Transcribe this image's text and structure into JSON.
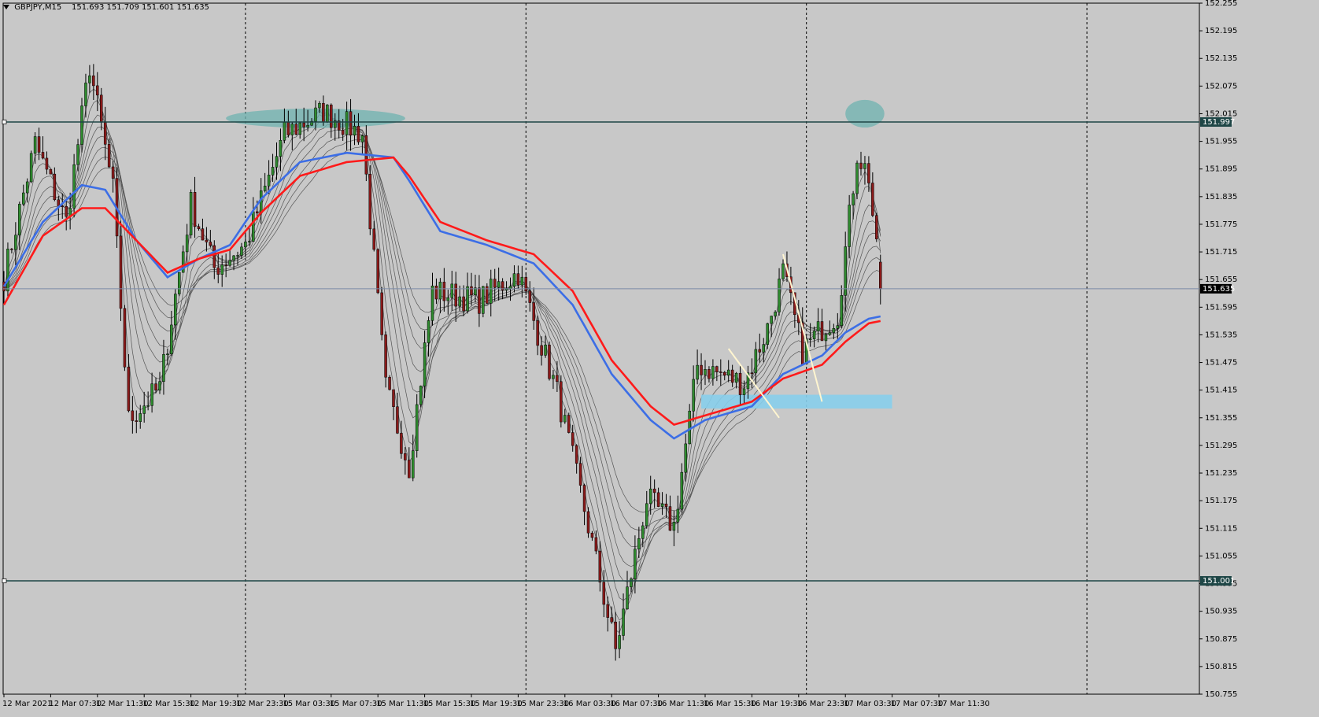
{
  "header": {
    "symbol": "GBPJPY,M15",
    "quotes": "151.693 151.709 151.601 151.635"
  },
  "colors": {
    "background": "#c8c8c8",
    "grid": "#000000",
    "bull_candle": "#2e8b2e",
    "bear_candle": "#8b1a1a",
    "wick": "#000000",
    "ema_red": "#ff1a1a",
    "ema_blue": "#3c6ee6",
    "ema_thin": "#555555",
    "hline": "#1e4646",
    "current_price_line": "#7c8aa6",
    "zone_blue": "#87ceeb",
    "ellipse": "#6fb3b0",
    "trendline": "#fff5d0"
  },
  "chart_data": {
    "type": "candlestick",
    "title": "",
    "symbol": "GBPJPY",
    "timeframe": "M15",
    "last_bar": {
      "open": 151.693,
      "high": 151.709,
      "low": 151.601,
      "close": 151.635
    },
    "ylim": [
      150.755,
      152.255
    ],
    "y_ticks": [
      "152.255",
      "152.195",
      "152.135",
      "152.075",
      "152.015",
      "151.955",
      "151.895",
      "151.835",
      "151.775",
      "151.715",
      "151.655",
      "151.595",
      "151.535",
      "151.475",
      "151.415",
      "151.355",
      "151.295",
      "151.235",
      "151.175",
      "151.115",
      "151.055",
      "150.995",
      "150.935",
      "150.875",
      "150.815",
      "150.755"
    ],
    "x_ticks": [
      "12 Mar 2021",
      "12 Mar 07:30",
      "12 Mar 11:30",
      "12 Mar 15:30",
      "12 Mar 19:30",
      "12 Mar 23:30",
      "15 Mar 03:30",
      "15 Mar 07:30",
      "15 Mar 11:30",
      "15 Mar 15:30",
      "15 Mar 19:30",
      "15 Mar 23:30",
      "16 Mar 03:30",
      "16 Mar 07:30",
      "16 Mar 11:30",
      "16 Mar 15:30",
      "16 Mar 19:30",
      "16 Mar 23:30",
      "17 Mar 03:30",
      "17 Mar 07:30",
      "17 Mar 11:30"
    ],
    "horizontal_levels": [
      {
        "price": 151.997,
        "label": "151.997"
      },
      {
        "price": 151.001,
        "label": "151.001"
      }
    ],
    "current_price": {
      "price": 151.635,
      "label": "151.635"
    },
    "anchors": [
      {
        "bar": 0,
        "price": 151.66
      },
      {
        "bar": 8,
        "price": 151.95
      },
      {
        "bar": 16,
        "price": 151.78
      },
      {
        "bar": 22,
        "price": 152.12
      },
      {
        "bar": 28,
        "price": 151.85
      },
      {
        "bar": 32,
        "price": 151.35
      },
      {
        "bar": 40,
        "price": 151.42
      },
      {
        "bar": 48,
        "price": 151.82
      },
      {
        "bar": 54,
        "price": 151.68
      },
      {
        "bar": 62,
        "price": 151.73
      },
      {
        "bar": 72,
        "price": 151.97
      },
      {
        "bar": 82,
        "price": 152.02
      },
      {
        "bar": 92,
        "price": 151.97
      },
      {
        "bar": 98,
        "price": 151.42
      },
      {
        "bar": 104,
        "price": 151.25
      },
      {
        "bar": 110,
        "price": 151.63
      },
      {
        "bar": 122,
        "price": 151.61
      },
      {
        "bar": 132,
        "price": 151.67
      },
      {
        "bar": 142,
        "price": 151.41
      },
      {
        "bar": 150,
        "price": 151.12
      },
      {
        "bar": 157,
        "price": 150.85
      },
      {
        "bar": 165,
        "price": 151.18
      },
      {
        "bar": 172,
        "price": 151.12
      },
      {
        "bar": 178,
        "price": 151.47
      },
      {
        "bar": 184,
        "price": 151.45
      },
      {
        "bar": 190,
        "price": 151.43
      },
      {
        "bar": 196,
        "price": 151.55
      },
      {
        "bar": 200,
        "price": 151.67
      },
      {
        "bar": 205,
        "price": 151.5
      },
      {
        "bar": 210,
        "price": 151.55
      },
      {
        "bar": 214,
        "price": 151.58
      },
      {
        "bar": 219,
        "price": 151.93
      },
      {
        "bar": 222,
        "price": 151.88
      },
      {
        "bar": 225,
        "price": 151.63
      }
    ],
    "ema_red": [
      {
        "bar": 0,
        "price": 151.6
      },
      {
        "bar": 10,
        "price": 151.75
      },
      {
        "bar": 20,
        "price": 151.81
      },
      {
        "bar": 26,
        "price": 151.81
      },
      {
        "bar": 34,
        "price": 151.74
      },
      {
        "bar": 42,
        "price": 151.67
      },
      {
        "bar": 50,
        "price": 151.7
      },
      {
        "bar": 58,
        "price": 151.72
      },
      {
        "bar": 66,
        "price": 151.8
      },
      {
        "bar": 76,
        "price": 151.88
      },
      {
        "bar": 88,
        "price": 151.91
      },
      {
        "bar": 100,
        "price": 151.92
      },
      {
        "bar": 104,
        "price": 151.88
      },
      {
        "bar": 112,
        "price": 151.78
      },
      {
        "bar": 124,
        "price": 151.74
      },
      {
        "bar": 136,
        "price": 151.71
      },
      {
        "bar": 146,
        "price": 151.63
      },
      {
        "bar": 156,
        "price": 151.48
      },
      {
        "bar": 166,
        "price": 151.38
      },
      {
        "bar": 172,
        "price": 151.34
      },
      {
        "bar": 180,
        "price": 151.36
      },
      {
        "bar": 192,
        "price": 151.39
      },
      {
        "bar": 200,
        "price": 151.44
      },
      {
        "bar": 210,
        "price": 151.47
      },
      {
        "bar": 216,
        "price": 151.52
      },
      {
        "bar": 222,
        "price": 151.56
      },
      {
        "bar": 225,
        "price": 151.565
      }
    ],
    "ema_blue": [
      {
        "bar": 0,
        "price": 151.64
      },
      {
        "bar": 10,
        "price": 151.78
      },
      {
        "bar": 20,
        "price": 151.86
      },
      {
        "bar": 26,
        "price": 151.85
      },
      {
        "bar": 34,
        "price": 151.74
      },
      {
        "bar": 42,
        "price": 151.66
      },
      {
        "bar": 50,
        "price": 151.7
      },
      {
        "bar": 58,
        "price": 151.73
      },
      {
        "bar": 66,
        "price": 151.83
      },
      {
        "bar": 76,
        "price": 151.91
      },
      {
        "bar": 88,
        "price": 151.93
      },
      {
        "bar": 100,
        "price": 151.92
      },
      {
        "bar": 104,
        "price": 151.87
      },
      {
        "bar": 112,
        "price": 151.76
      },
      {
        "bar": 124,
        "price": 151.73
      },
      {
        "bar": 136,
        "price": 151.69
      },
      {
        "bar": 146,
        "price": 151.6
      },
      {
        "bar": 156,
        "price": 151.45
      },
      {
        "bar": 166,
        "price": 151.35
      },
      {
        "bar": 172,
        "price": 151.31
      },
      {
        "bar": 180,
        "price": 151.35
      },
      {
        "bar": 192,
        "price": 151.38
      },
      {
        "bar": 200,
        "price": 151.45
      },
      {
        "bar": 210,
        "price": 151.49
      },
      {
        "bar": 216,
        "price": 151.54
      },
      {
        "bar": 222,
        "price": 151.57
      },
      {
        "bar": 225,
        "price": 151.575
      }
    ],
    "trendlines": [
      {
        "from": {
          "bar": 186,
          "price": 151.505
        },
        "to": {
          "bar": 199,
          "price": 151.355
        }
      },
      {
        "from": {
          "bar": 200,
          "price": 151.71
        },
        "to": {
          "bar": 210,
          "price": 151.39
        }
      }
    ],
    "zones": [
      {
        "from_bar": 179,
        "to_bar": 228,
        "price_high": 151.405,
        "price_low": 151.375
      }
    ],
    "ellipses": [
      {
        "center_bar": 80,
        "price": 152.005,
        "bar_radius": 23,
        "price_radius": 0.021
      },
      {
        "center_bar": 221,
        "price": 152.015,
        "bar_radius": 5,
        "price_radius": 0.03
      }
    ],
    "grid": true,
    "separator_dates": [
      "12 Mar 23:30",
      "15 Mar 23:30",
      "16 Mar 23:30",
      "17 Mar 11:30"
    ]
  }
}
